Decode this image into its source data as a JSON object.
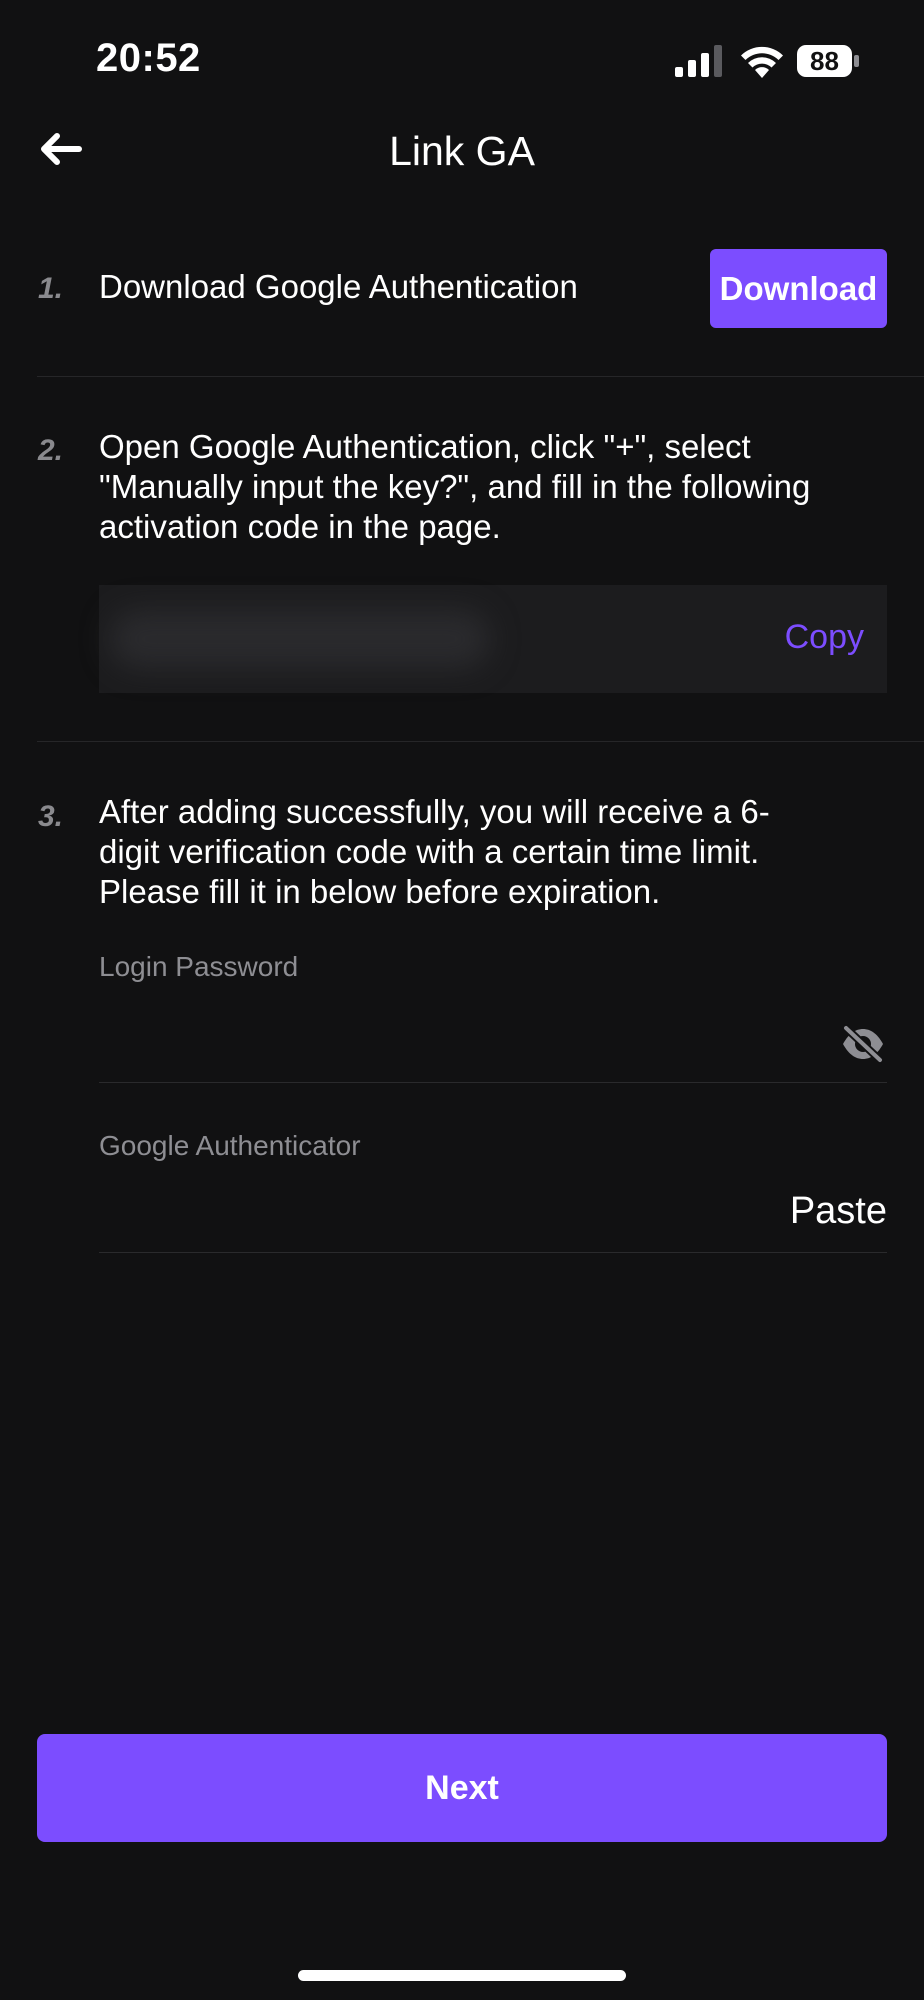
{
  "status_bar": {
    "time": "20:52",
    "battery": "88",
    "icons": [
      "cellular-signal-icon",
      "wifi-icon",
      "battery-icon"
    ]
  },
  "header": {
    "title": "Link GA",
    "back_icon": "arrow-left-icon"
  },
  "steps": [
    {
      "number": "1.",
      "text": "Download Google Authentication",
      "button_label": "Download"
    },
    {
      "number": "2.",
      "lines": [
        "Open Google Authentication, click \"+\", select",
        "\"Manually input the key?\", and fill in the following",
        "activation code in the page."
      ],
      "copy_label": "Copy"
    },
    {
      "number": "3.",
      "lines": [
        "After adding successfully, you will receive a 6-",
        "digit verification code with a certain time limit.",
        "Please fill it in below before expiration."
      ]
    }
  ],
  "form": {
    "password_label": "Login Password",
    "password_toggle_icon": "eye-slash-icon",
    "ga_label": "Google Authenticator",
    "paste_label": "Paste"
  },
  "next_button": "Next",
  "colors": {
    "background": "#111112",
    "accent": "#7c4dff",
    "muted_text": "#8e8e93",
    "divider": "#262628"
  }
}
